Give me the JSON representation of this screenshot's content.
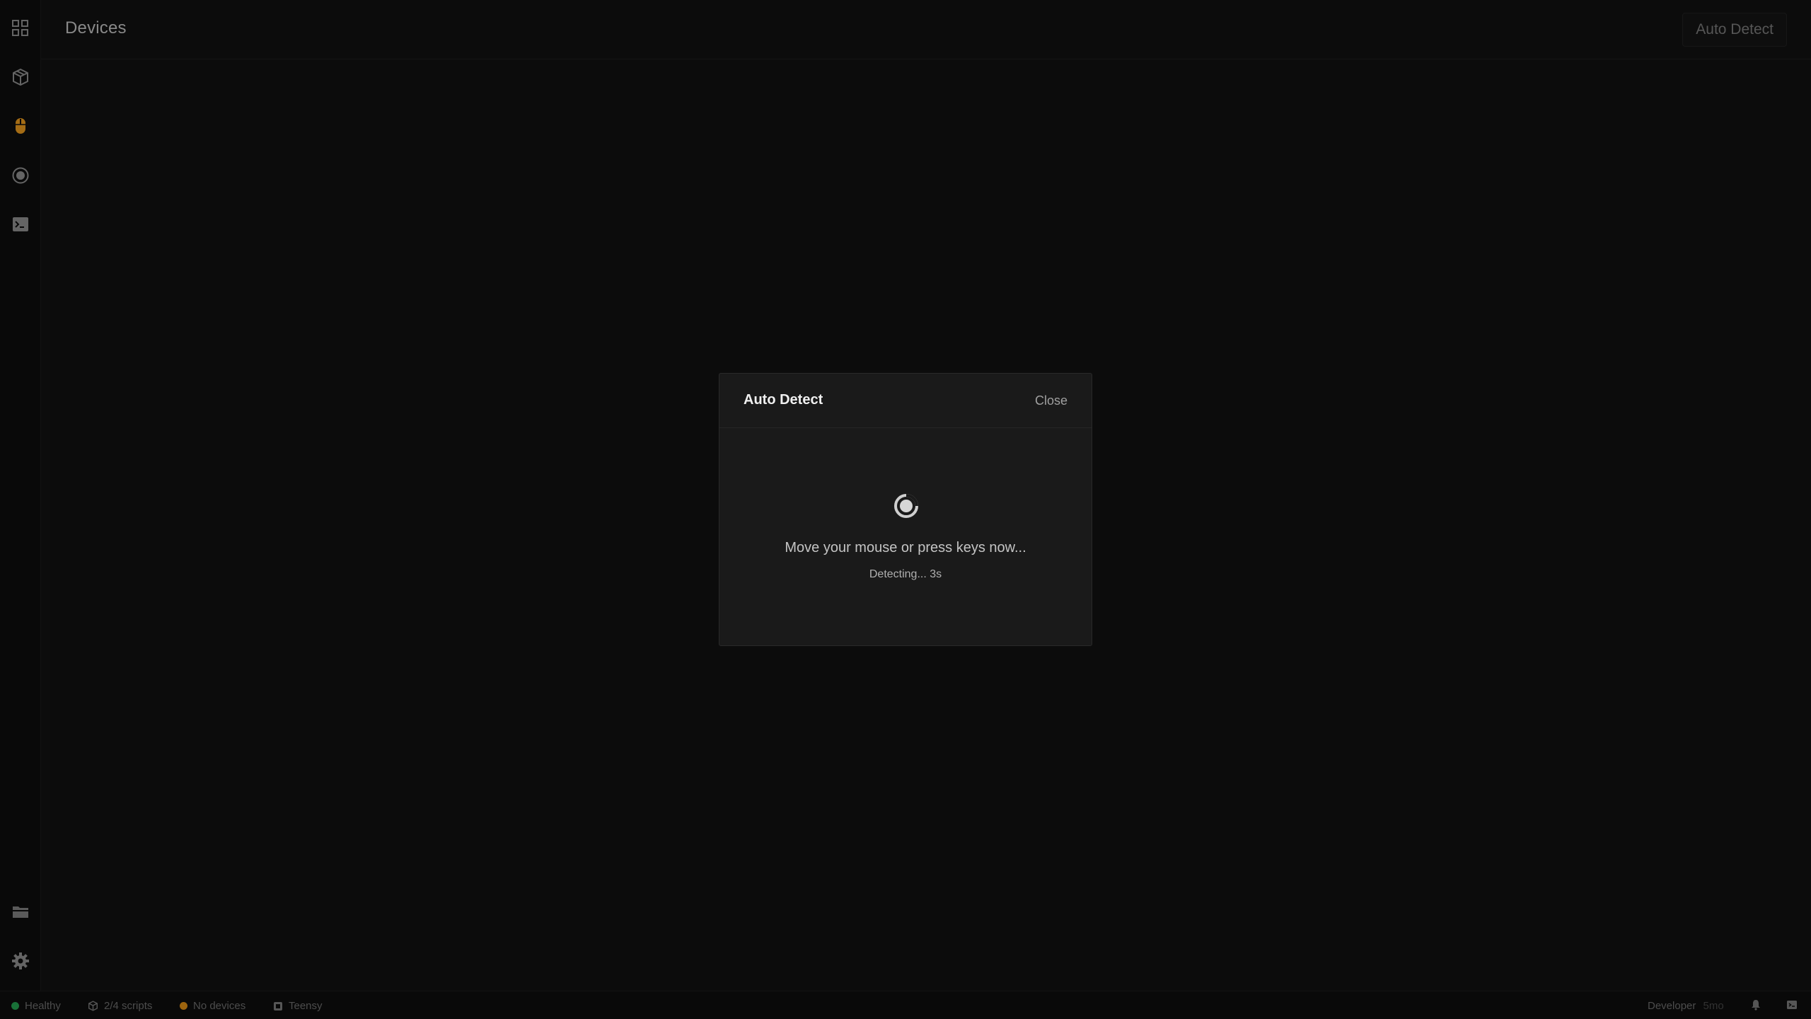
{
  "header": {
    "title": "Devices",
    "auto_detect_label": "Auto Detect"
  },
  "sidebar": {
    "items": [
      {
        "icon": "grid-icon"
      },
      {
        "icon": "package-icon"
      },
      {
        "icon": "mouse-icon",
        "active": true
      },
      {
        "icon": "record-icon"
      },
      {
        "icon": "terminal-icon"
      }
    ],
    "bottom_items": [
      {
        "icon": "folder-icon"
      },
      {
        "icon": "gear-icon"
      }
    ]
  },
  "modal": {
    "title": "Auto Detect",
    "close_label": "Close",
    "message": "Move your mouse or press keys now...",
    "status": "Detecting... 3s"
  },
  "statusbar": {
    "health": {
      "label": "Healthy",
      "color": "#1f8a45"
    },
    "scripts": {
      "label": "2/4 scripts"
    },
    "devices": {
      "label": "No devices",
      "color": "#c07a12"
    },
    "board": {
      "label": "Teensy"
    },
    "mode": {
      "label": "Developer"
    },
    "mode_extra": {
      "label": "5mo"
    }
  },
  "colors": {
    "accent": "#c8841a",
    "background": "#0f0f0f",
    "modal_bg": "#1a1a1a"
  }
}
